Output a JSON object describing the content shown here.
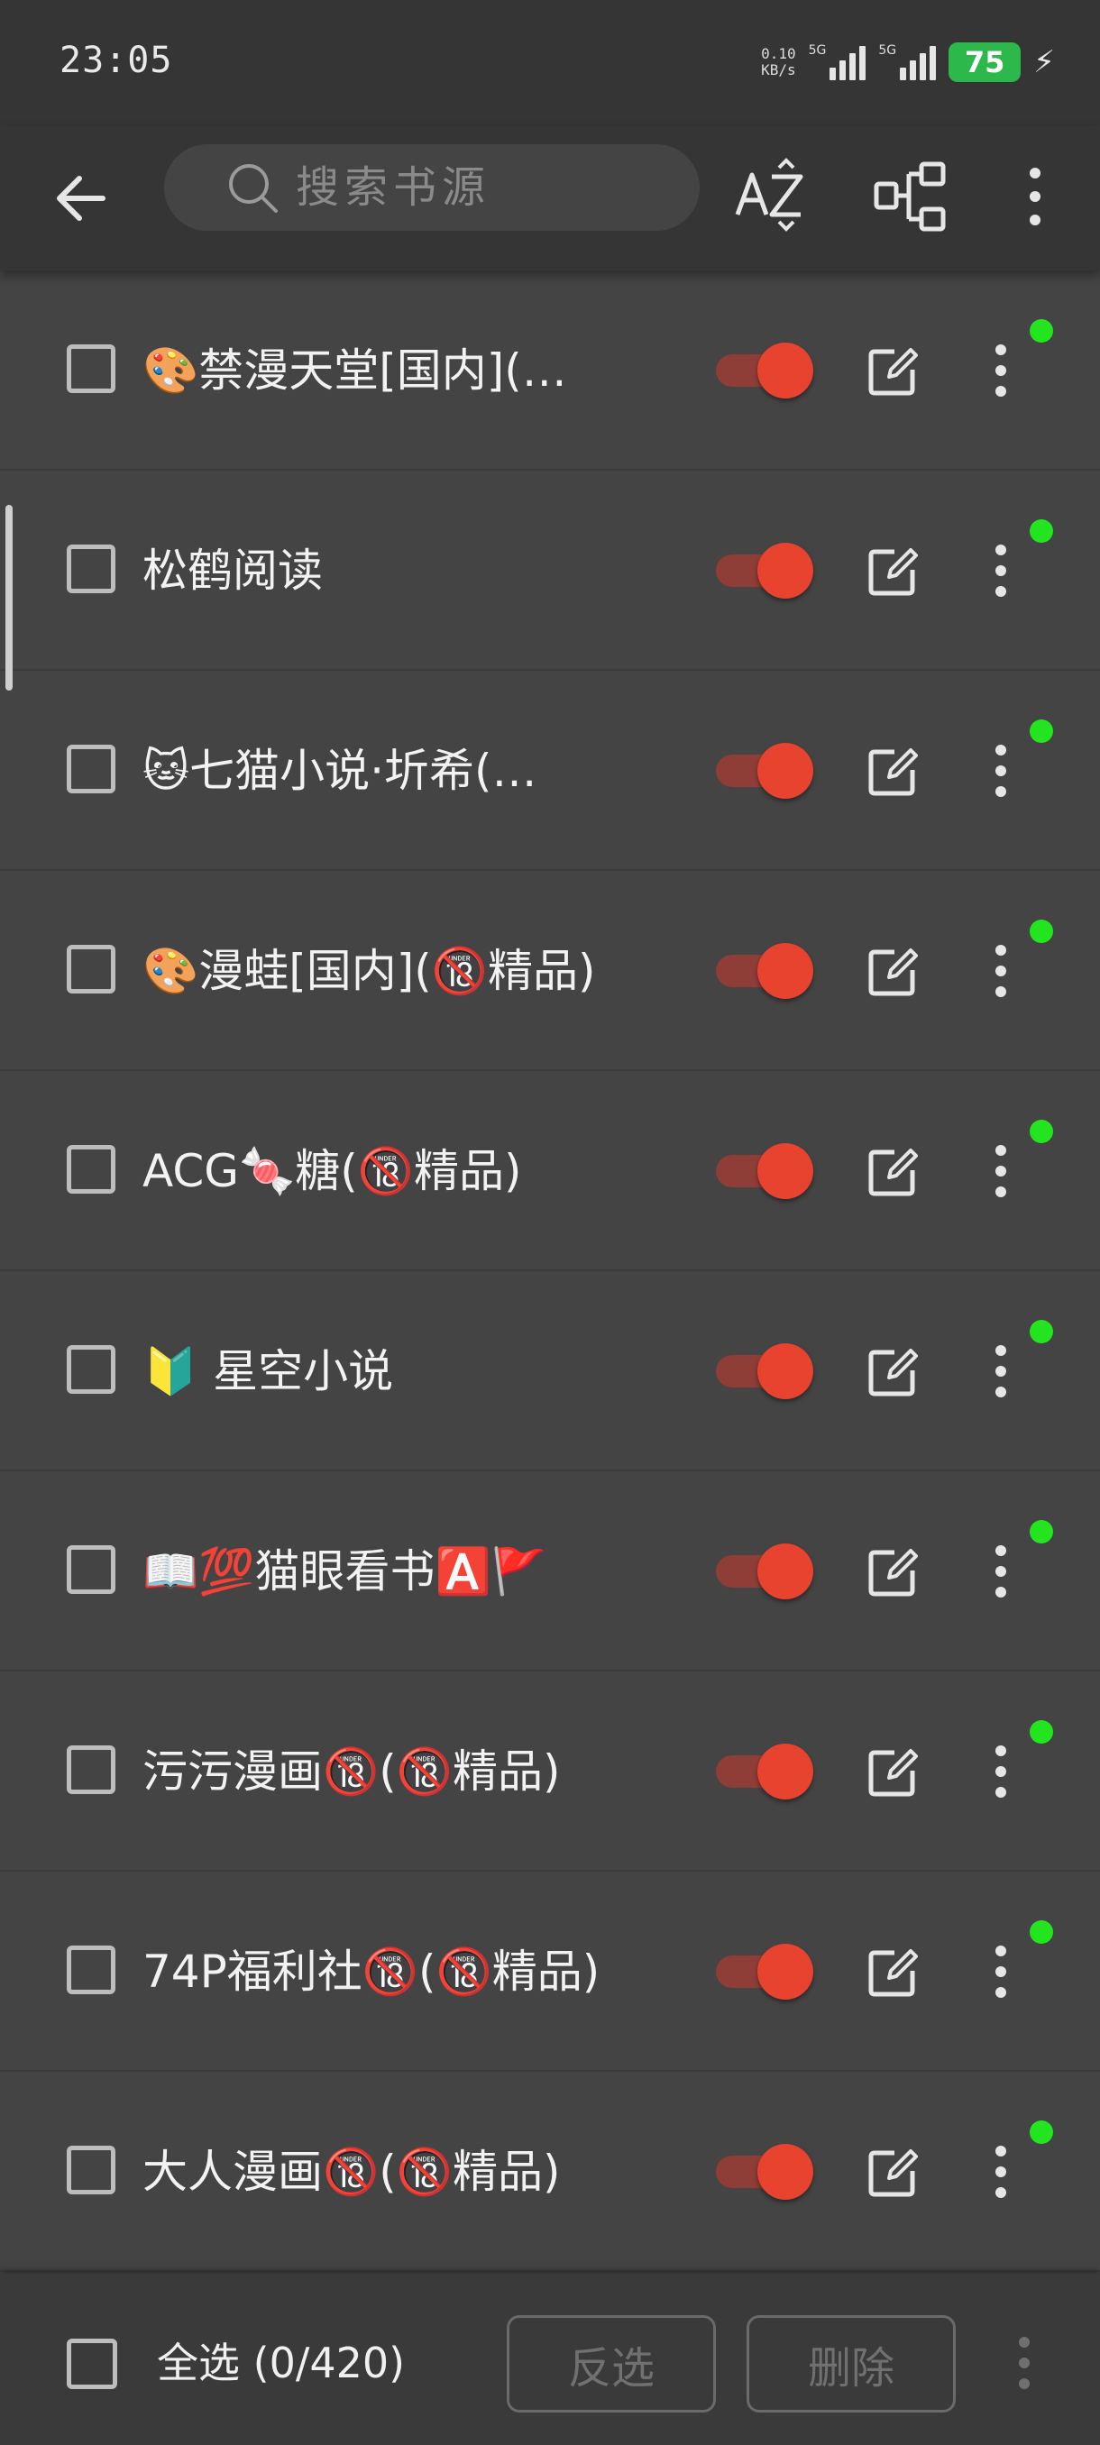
{
  "status_bar": {
    "time": "23:05",
    "net_speed_value": "0.10",
    "net_speed_unit": "KB/s",
    "sim1_label": "5G",
    "sim2_label": "5G",
    "battery_level": "75"
  },
  "header": {
    "search_placeholder": "搜索书源",
    "sort_icon": "az-sort-icon",
    "group_icon": "group-icon",
    "overflow_icon": "more-vertical-icon"
  },
  "sources": [
    {
      "name": "🎨禁漫天堂[国内](…",
      "enabled": true,
      "checked": false
    },
    {
      "name": "松鹤阅读",
      "enabled": true,
      "checked": false
    },
    {
      "name": "🐱七猫小说·圻希(…",
      "enabled": true,
      "checked": false
    },
    {
      "name": "🎨漫蛙[国内](🔞精品)",
      "enabled": true,
      "checked": false
    },
    {
      "name": "ACG🍬糖(🔞精品)",
      "enabled": true,
      "checked": false
    },
    {
      "name": "🔰 星空小说",
      "enabled": true,
      "checked": false
    },
    {
      "name": "📖💯猫眼看书🅰️🚩",
      "enabled": true,
      "checked": false
    },
    {
      "name": "污污漫画🔞(🔞精品)",
      "enabled": true,
      "checked": false
    },
    {
      "name": "74P福利社🔞(🔞精品)",
      "enabled": true,
      "checked": false
    },
    {
      "name": "大人漫画🔞(🔞精品)",
      "enabled": true,
      "checked": false
    }
  ],
  "bottom_bar": {
    "select_all_label": "全选 (0/420)",
    "invert_label": "反选",
    "delete_label": "删除"
  },
  "colors": {
    "background": "#444444",
    "toolbar": "#353535",
    "switch_on": "#e8432e",
    "status_dot": "#22e51f",
    "battery": "#2db84b"
  }
}
